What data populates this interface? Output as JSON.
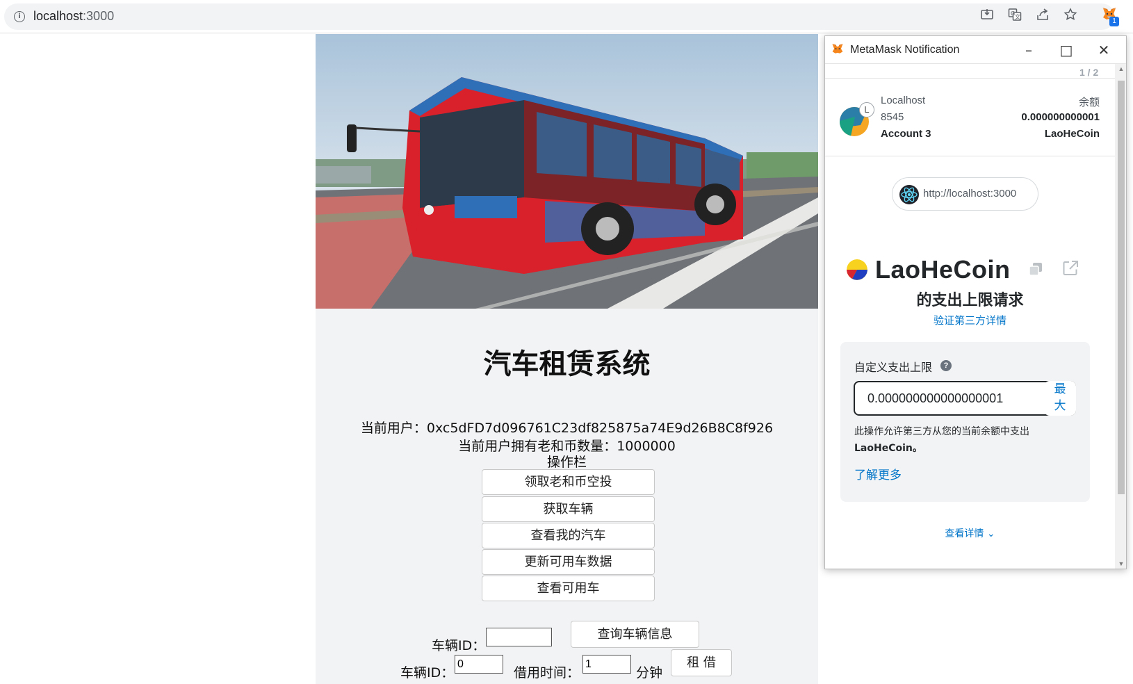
{
  "browser": {
    "url_host": "localhost",
    "url_port": ":3000",
    "extension_badge": "1"
  },
  "app": {
    "title": "汽车租赁系统",
    "current_user": "当前用户：0xc5dFD7d096761C23df825875a74E9d26B8C8f926",
    "balance_line": "当前用户拥有老和币数量：1000000",
    "ops_title": "操作栏",
    "buttons": [
      "领取老和币空投",
      "获取车辆",
      "查看我的汽车",
      "更新可用车数据",
      "查看可用车"
    ],
    "query_form": {
      "car_id_label": "车辆ID：",
      "car_id_value": "",
      "query_button": "查询车辆信息"
    },
    "borrow_form": {
      "car_id_label": "车辆ID：",
      "car_id_value": "0",
      "time_label": "借用时间：",
      "time_value": "1",
      "unit_label": "分钟",
      "borrow_button": "租 借"
    }
  },
  "metamask": {
    "window_title": "MetaMask Notification",
    "page_counter": "1 / 2",
    "network": "Localhost",
    "port": "8545",
    "account": "Account 3",
    "balance_label": "余额",
    "balance_value": "0.000000000001",
    "balance_token": "LaoHeCoin",
    "origin": "http://localhost:3000",
    "token_name": "LaoHeCoin",
    "spend_title": "的支出上限请求",
    "verify_link": "验证第三方详情",
    "custom_label": "自定义支出上限",
    "amount_value": "0.000000000000000001",
    "max_label_1": "最",
    "max_label_2": "大",
    "description": "此操作允许第三方从您的当前余额中支出",
    "description_token": "LaoHeCoin。",
    "learn_more": "了解更多",
    "view_details": "查看详情"
  },
  "colors": {
    "mm_link": "#0376c9",
    "page_bg": "#f2f3f5"
  }
}
